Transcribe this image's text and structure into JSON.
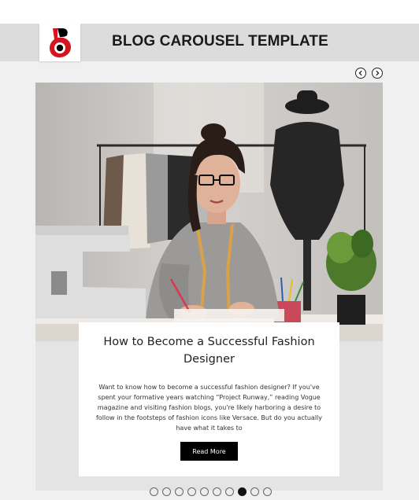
{
  "header": {
    "title": "BLOG CAROUSEL TEMPLATE",
    "logo_icon": "brand-logo",
    "accent_color": "#d4141e"
  },
  "carousel": {
    "prev_icon": "chevron-left-icon",
    "next_icon": "chevron-right-icon",
    "slide": {
      "image": "woman-fashion-designer-sketching-photo",
      "title": "How to Become a Successful Fashion Designer",
      "excerpt": "Want to know how to become a successful fashion designer? If you've spent your formative years watching “Project Runway,” reading Vogue magazine and visiting fashion blogs, you're likely harboring a desire to follow in the footsteps of fashion icons like Versace. But do you actually have what it takes to",
      "button_label": "Read More"
    },
    "dots": {
      "count": 10,
      "active_index": 7
    }
  }
}
